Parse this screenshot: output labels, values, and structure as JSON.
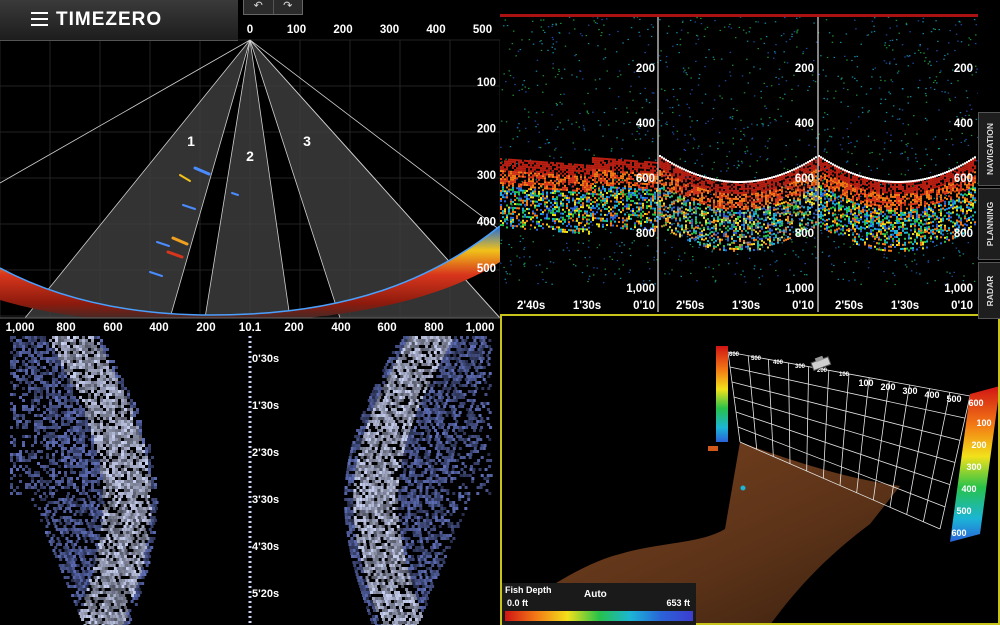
{
  "app": {
    "title": "TIMEZERO",
    "undo_icon": "undo-icon",
    "redo_icon": "redo-icon"
  },
  "side_tabs": [
    "NAVIGATION",
    "PLANNING",
    "RADAR"
  ],
  "sonar_fan": {
    "depth_top_ticks": [
      "0",
      "100",
      "200",
      "300",
      "400",
      "500"
    ],
    "depth_right_ticks": [
      "100",
      "200",
      "300",
      "400",
      "500"
    ],
    "range_ticks": [
      "1,000",
      "800",
      "600",
      "400",
      "200",
      "10.1",
      "200",
      "400",
      "600",
      "800",
      "1,000"
    ],
    "beams": [
      "1",
      "2",
      "3"
    ]
  },
  "echo_history": {
    "panels": [
      {
        "time_ticks": [
          "2'40s",
          "1'30s",
          "0'10"
        ]
      },
      {
        "time_ticks": [
          "2'50s",
          "1'30s",
          "0'10"
        ]
      },
      {
        "time_ticks": [
          "2'50s",
          "1'30s",
          "0'10"
        ]
      }
    ],
    "depth_ticks": [
      "200",
      "400",
      "600",
      "800",
      "1,000"
    ]
  },
  "side_scan": {
    "time_ticks": [
      "0'30s",
      "1'30s",
      "2'30s",
      "3'30s",
      "4'30s",
      "5'20s"
    ]
  },
  "view_3d": {
    "range_ticks": [
      "600",
      "500",
      "400",
      "300",
      "200",
      "100",
      "100",
      "200",
      "300",
      "400",
      "500",
      "600"
    ],
    "depth_scale": [
      "100",
      "200",
      "300",
      "400",
      "500",
      "600"
    ],
    "fish_depth": {
      "title": "Fish Depth",
      "mode": "Auto",
      "min": "0.0 ft",
      "max": "653 ft"
    },
    "border_color": "#c8c41a"
  },
  "colors": {
    "sea_floor": "#8a4a22",
    "side_scan": "#7f8ed0",
    "echo_red": "#d8361c"
  }
}
